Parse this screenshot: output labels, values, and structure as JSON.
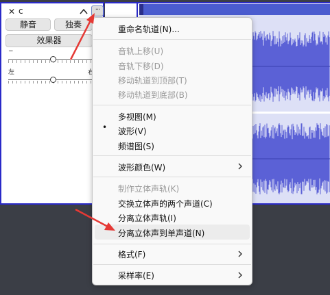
{
  "track": {
    "close_glyph": "✕",
    "name": "c",
    "menu_glyph": "···",
    "mute_label": "静音",
    "solo_label": "独奏",
    "effects_label": "效果器",
    "gain_minus": "−",
    "pan_left": "左",
    "pan_right": "右"
  },
  "context_menu": {
    "items": [
      {
        "label": "重命名轨道(N)...",
        "enabled": true
      },
      {
        "label": "音轨上移(U)",
        "enabled": false
      },
      {
        "label": "音轨下移(D)",
        "enabled": false
      },
      {
        "label": "移动轨道到顶部(T)",
        "enabled": false
      },
      {
        "label": "移动轨道到底部(B)",
        "enabled": false
      },
      {
        "label": "多视图(M)",
        "enabled": true
      },
      {
        "label": "波形(V)",
        "enabled": true,
        "checked": true
      },
      {
        "label": "频谱图(S)",
        "enabled": true
      },
      {
        "label": "波形颜色(W)",
        "enabled": true,
        "submenu": true
      },
      {
        "label": "制作立体声轨(K)",
        "enabled": false
      },
      {
        "label": "交换立体声的两个声道(C)",
        "enabled": true
      },
      {
        "label": "分离立体声轨(I)",
        "enabled": true
      },
      {
        "label": "分离立体声到单声道(N)",
        "enabled": true,
        "hovered": true
      },
      {
        "label": "格式(F)",
        "enabled": true,
        "submenu": true
      },
      {
        "label": "采样率(E)",
        "enabled": true,
        "submenu": true
      }
    ],
    "check_glyph": "•"
  },
  "colors": {
    "accent": "#2a2ac8",
    "waveform": "#5b61d6",
    "clip_header": "#4b5ccf",
    "arrow": "#e53935"
  }
}
